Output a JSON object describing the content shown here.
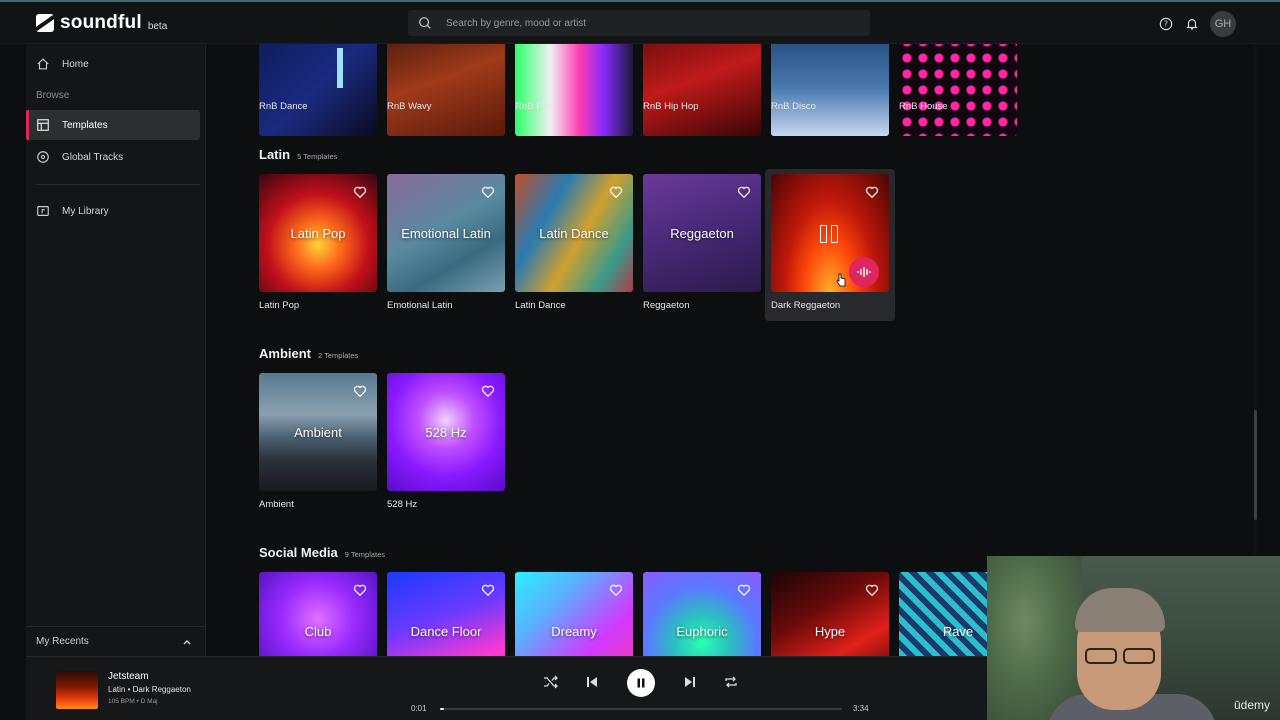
{
  "app": {
    "name": "soundful",
    "badge": "beta"
  },
  "search": {
    "placeholder": "Search by genre, mood or artist"
  },
  "user": {
    "initials": "GH"
  },
  "sidebar": {
    "home": "Home",
    "section_label": "Browse",
    "templates": "Templates",
    "global_tracks": "Global Tracks",
    "my_library": "My Library",
    "recents": "My Recents"
  },
  "rnb_row": {
    "labels": [
      "RnB Dance",
      "RnB Wavy",
      "RnB Pop",
      "RnB Hip Hop",
      "RnB Disco",
      "RnB House"
    ]
  },
  "latin": {
    "title": "Latin",
    "count": "5 Templates",
    "cards": [
      {
        "overlay": "Latin Pop",
        "label": "Latin Pop"
      },
      {
        "overlay": "Emotional Latin",
        "label": "Emotional Latin"
      },
      {
        "overlay": "Latin Dance",
        "label": "Latin Dance"
      },
      {
        "overlay": "Reggaeton",
        "label": "Reggaeton"
      },
      {
        "overlay": "",
        "label": "Dark Reggaeton"
      }
    ]
  },
  "ambient": {
    "title": "Ambient",
    "count": "2 Templates",
    "cards": [
      {
        "overlay": "Ambient",
        "label": "Ambient"
      },
      {
        "overlay": "528 Hz",
        "label": "528 Hz"
      }
    ]
  },
  "social": {
    "title": "Social Media",
    "count": "9 Templates",
    "cards": [
      {
        "overlay": "Club"
      },
      {
        "overlay": "Dance Floor"
      },
      {
        "overlay": "Dreamy"
      },
      {
        "overlay": "Euphoric"
      },
      {
        "overlay": "Hype"
      },
      {
        "overlay": "Rave"
      }
    ]
  },
  "player": {
    "title": "Jetsteam",
    "subtitle": "Latin • Dark Reggaeton",
    "meta": "105 BPM • D Maj",
    "current_time": "0:01",
    "total_time": "3:34",
    "progress": 0.005
  },
  "watermark": "ūdemy",
  "colors": {
    "accent": "#e0245e",
    "background": "#0d0e10",
    "sidebar": "#141517"
  }
}
